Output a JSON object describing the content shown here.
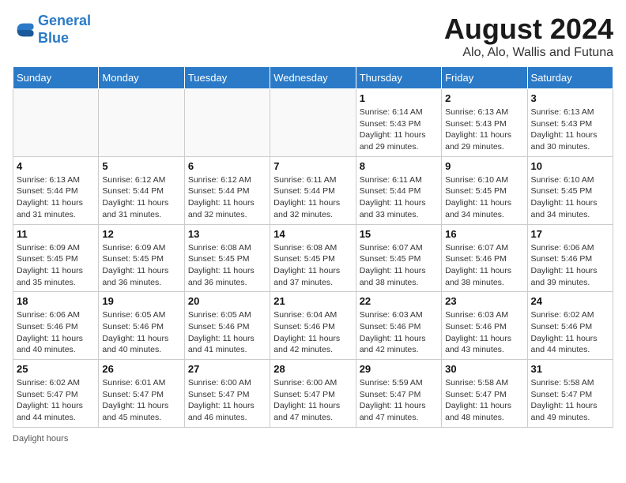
{
  "header": {
    "logo_line1": "General",
    "logo_line2": "Blue",
    "title": "August 2024",
    "subtitle": "Alo, Alo, Wallis and Futuna"
  },
  "days_of_week": [
    "Sunday",
    "Monday",
    "Tuesday",
    "Wednesday",
    "Thursday",
    "Friday",
    "Saturday"
  ],
  "weeks": [
    [
      {
        "day": "",
        "info": ""
      },
      {
        "day": "",
        "info": ""
      },
      {
        "day": "",
        "info": ""
      },
      {
        "day": "",
        "info": ""
      },
      {
        "day": "1",
        "info": "Sunrise: 6:14 AM\nSunset: 5:43 PM\nDaylight: 11 hours and 29 minutes."
      },
      {
        "day": "2",
        "info": "Sunrise: 6:13 AM\nSunset: 5:43 PM\nDaylight: 11 hours and 29 minutes."
      },
      {
        "day": "3",
        "info": "Sunrise: 6:13 AM\nSunset: 5:43 PM\nDaylight: 11 hours and 30 minutes."
      }
    ],
    [
      {
        "day": "4",
        "info": "Sunrise: 6:13 AM\nSunset: 5:44 PM\nDaylight: 11 hours and 31 minutes."
      },
      {
        "day": "5",
        "info": "Sunrise: 6:12 AM\nSunset: 5:44 PM\nDaylight: 11 hours and 31 minutes."
      },
      {
        "day": "6",
        "info": "Sunrise: 6:12 AM\nSunset: 5:44 PM\nDaylight: 11 hours and 32 minutes."
      },
      {
        "day": "7",
        "info": "Sunrise: 6:11 AM\nSunset: 5:44 PM\nDaylight: 11 hours and 32 minutes."
      },
      {
        "day": "8",
        "info": "Sunrise: 6:11 AM\nSunset: 5:44 PM\nDaylight: 11 hours and 33 minutes."
      },
      {
        "day": "9",
        "info": "Sunrise: 6:10 AM\nSunset: 5:45 PM\nDaylight: 11 hours and 34 minutes."
      },
      {
        "day": "10",
        "info": "Sunrise: 6:10 AM\nSunset: 5:45 PM\nDaylight: 11 hours and 34 minutes."
      }
    ],
    [
      {
        "day": "11",
        "info": "Sunrise: 6:09 AM\nSunset: 5:45 PM\nDaylight: 11 hours and 35 minutes."
      },
      {
        "day": "12",
        "info": "Sunrise: 6:09 AM\nSunset: 5:45 PM\nDaylight: 11 hours and 36 minutes."
      },
      {
        "day": "13",
        "info": "Sunrise: 6:08 AM\nSunset: 5:45 PM\nDaylight: 11 hours and 36 minutes."
      },
      {
        "day": "14",
        "info": "Sunrise: 6:08 AM\nSunset: 5:45 PM\nDaylight: 11 hours and 37 minutes."
      },
      {
        "day": "15",
        "info": "Sunrise: 6:07 AM\nSunset: 5:45 PM\nDaylight: 11 hours and 38 minutes."
      },
      {
        "day": "16",
        "info": "Sunrise: 6:07 AM\nSunset: 5:46 PM\nDaylight: 11 hours and 38 minutes."
      },
      {
        "day": "17",
        "info": "Sunrise: 6:06 AM\nSunset: 5:46 PM\nDaylight: 11 hours and 39 minutes."
      }
    ],
    [
      {
        "day": "18",
        "info": "Sunrise: 6:06 AM\nSunset: 5:46 PM\nDaylight: 11 hours and 40 minutes."
      },
      {
        "day": "19",
        "info": "Sunrise: 6:05 AM\nSunset: 5:46 PM\nDaylight: 11 hours and 40 minutes."
      },
      {
        "day": "20",
        "info": "Sunrise: 6:05 AM\nSunset: 5:46 PM\nDaylight: 11 hours and 41 minutes."
      },
      {
        "day": "21",
        "info": "Sunrise: 6:04 AM\nSunset: 5:46 PM\nDaylight: 11 hours and 42 minutes."
      },
      {
        "day": "22",
        "info": "Sunrise: 6:03 AM\nSunset: 5:46 PM\nDaylight: 11 hours and 42 minutes."
      },
      {
        "day": "23",
        "info": "Sunrise: 6:03 AM\nSunset: 5:46 PM\nDaylight: 11 hours and 43 minutes."
      },
      {
        "day": "24",
        "info": "Sunrise: 6:02 AM\nSunset: 5:46 PM\nDaylight: 11 hours and 44 minutes."
      }
    ],
    [
      {
        "day": "25",
        "info": "Sunrise: 6:02 AM\nSunset: 5:47 PM\nDaylight: 11 hours and 44 minutes."
      },
      {
        "day": "26",
        "info": "Sunrise: 6:01 AM\nSunset: 5:47 PM\nDaylight: 11 hours and 45 minutes."
      },
      {
        "day": "27",
        "info": "Sunrise: 6:00 AM\nSunset: 5:47 PM\nDaylight: 11 hours and 46 minutes."
      },
      {
        "day": "28",
        "info": "Sunrise: 6:00 AM\nSunset: 5:47 PM\nDaylight: 11 hours and 47 minutes."
      },
      {
        "day": "29",
        "info": "Sunrise: 5:59 AM\nSunset: 5:47 PM\nDaylight: 11 hours and 47 minutes."
      },
      {
        "day": "30",
        "info": "Sunrise: 5:58 AM\nSunset: 5:47 PM\nDaylight: 11 hours and 48 minutes."
      },
      {
        "day": "31",
        "info": "Sunrise: 5:58 AM\nSunset: 5:47 PM\nDaylight: 11 hours and 49 minutes."
      }
    ]
  ],
  "footer": {
    "daylight_label": "Daylight hours"
  }
}
